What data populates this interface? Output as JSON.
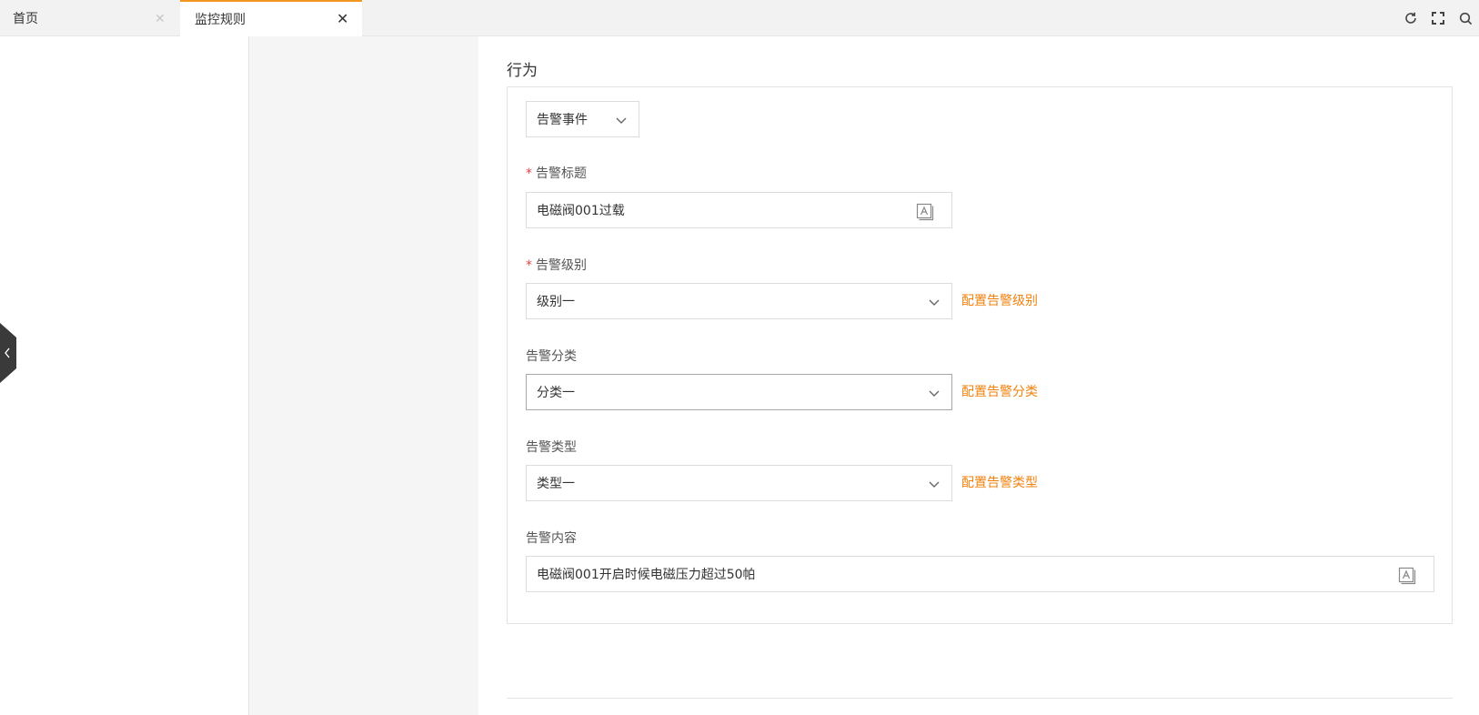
{
  "tabs": [
    {
      "label": "首页",
      "active": false
    },
    {
      "label": "监控规则",
      "active": true
    }
  ],
  "toolbar_icons": [
    "refresh-icon",
    "fullscreen-icon",
    "search-icon"
  ],
  "section": {
    "title": "行为"
  },
  "action_type": {
    "value": "告警事件"
  },
  "alarm_title": {
    "label": "告警标题",
    "required": true,
    "value": "电磁阀001过载"
  },
  "alarm_level": {
    "label": "告警级别",
    "required": true,
    "value": "级别一",
    "config_link": "配置告警级别"
  },
  "alarm_category": {
    "label": "告警分类",
    "value": "分类一",
    "config_link": "配置告警分类"
  },
  "alarm_type": {
    "label": "告警类型",
    "value": "类型一",
    "config_link": "配置告警类型"
  },
  "alarm_content": {
    "label": "告警内容",
    "value": "电磁阀001开启时候电磁压力超过50帕"
  },
  "colors": {
    "accent": "#f0820f",
    "required": "#e54545",
    "tab_top_border": "#f0961e"
  }
}
